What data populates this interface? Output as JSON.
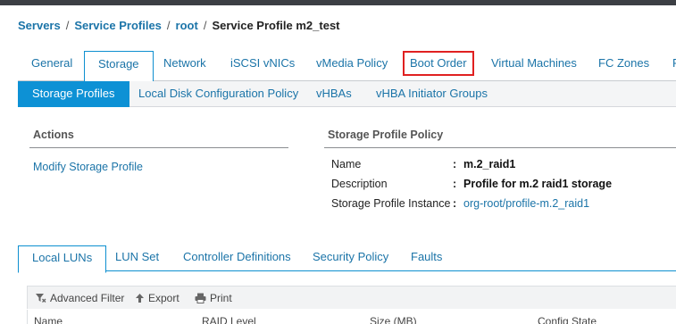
{
  "breadcrumb": {
    "items": [
      "Servers",
      "Service Profiles",
      "root"
    ],
    "current": "Service Profile m2_test",
    "separator": "/"
  },
  "main_tabs": [
    "General",
    "Storage",
    "Network",
    "iSCSI vNICs",
    "vMedia Policy",
    "Boot Order",
    "Virtual Machines",
    "FC Zones",
    "P"
  ],
  "main_tab_active": "Storage",
  "sub_tabs": [
    "Storage Profiles",
    "Local Disk Configuration Policy",
    "vHBAs",
    "vHBA Initiator Groups"
  ],
  "sub_tab_active": "Storage Profiles",
  "actions": {
    "title": "Actions",
    "items": [
      "Modify Storage Profile"
    ]
  },
  "policy": {
    "title": "Storage Profile Policy",
    "rows": [
      {
        "label": "Name",
        "colon": ":",
        "value": "m.2_raid1"
      },
      {
        "label": "Description",
        "colon": ":",
        "value": "Profile for m.2 raid1 storage"
      },
      {
        "label": "Storage Profile Instance",
        "colon": ":",
        "value": "org-root/profile-m.2_raid1"
      }
    ]
  },
  "lower_tabs": [
    "Local LUNs",
    "LUN Set",
    "Controller Definitions",
    "Security Policy",
    "Faults"
  ],
  "lower_tab_active": "Local LUNs",
  "toolbar": {
    "filter_label": "Advanced Filter",
    "export_label": "Export",
    "print_label": "Print"
  },
  "table": {
    "columns": [
      "Name",
      "RAID Level",
      "Size (MB)",
      "Config State"
    ]
  },
  "colors": {
    "accent": "#0d91d5",
    "link": "#1b74a8",
    "highlight_box": "#e02020"
  }
}
